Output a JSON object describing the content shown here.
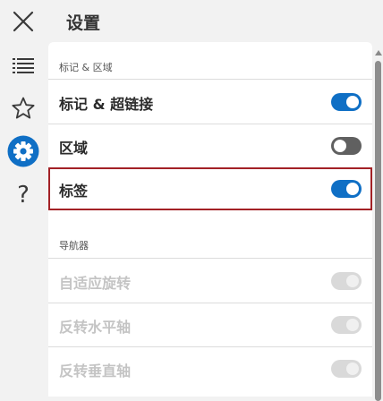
{
  "app": {
    "title": "设置"
  },
  "rail": {
    "items": [
      {
        "name": "close-button",
        "icon": "close-icon"
      },
      {
        "name": "list-button",
        "icon": "list-icon"
      },
      {
        "name": "favorites-button",
        "icon": "star-icon"
      },
      {
        "name": "settings-button",
        "icon": "gear-icon",
        "active": true,
        "accent": "#0f6fc5"
      },
      {
        "name": "help-button",
        "icon": "help-icon",
        "glyph": "?"
      }
    ]
  },
  "sections": [
    {
      "header": "标记 & 区域",
      "rows": [
        {
          "label": "标记 & 超链接",
          "state": "on",
          "enabled": true
        },
        {
          "label": "区域",
          "state": "off",
          "enabled": true
        },
        {
          "label": "标签",
          "state": "on",
          "enabled": true,
          "focused": true
        }
      ]
    },
    {
      "header": "导航器",
      "rows": [
        {
          "label": "自适应旋转",
          "state": "on",
          "enabled": false
        },
        {
          "label": "反转水平轴",
          "state": "on",
          "enabled": false
        },
        {
          "label": "反转垂直轴",
          "state": "on",
          "enabled": false
        }
      ]
    }
  ],
  "colors": {
    "toggle_on": "#0f6fc5",
    "toggle_off": "#606060",
    "focus_outline": "#a32126",
    "disabled_text": "#c4c4c4"
  }
}
